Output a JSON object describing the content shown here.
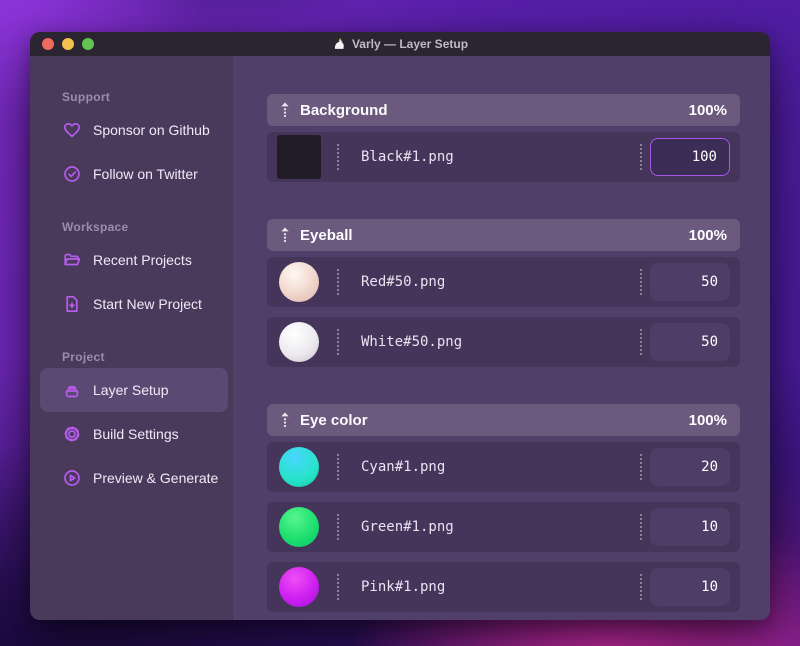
{
  "window": {
    "title": "Varly — Layer Setup",
    "app_icon": "unicorn-icon"
  },
  "sidebar": {
    "sections": [
      {
        "label": "Support",
        "items": [
          {
            "icon": "heart-icon",
            "label": "Sponsor on Github"
          },
          {
            "icon": "badge-check-icon",
            "label": "Follow on Twitter"
          }
        ]
      },
      {
        "label": "Workspace",
        "items": [
          {
            "icon": "folder-open-icon",
            "label": "Recent Projects"
          },
          {
            "icon": "file-plus-icon",
            "label": "Start New Project"
          }
        ]
      },
      {
        "label": "Project",
        "items": [
          {
            "icon": "layers-stack-icon",
            "label": "Layer Setup",
            "active": true
          },
          {
            "icon": "gear-icon",
            "label": "Build Settings"
          },
          {
            "icon": "play-circle-icon",
            "label": "Preview & Generate"
          }
        ]
      }
    ]
  },
  "main": {
    "groups": [
      {
        "name": "Background",
        "opacity": "100%",
        "layers": [
          {
            "thumb": "black-square",
            "file": "Black#1.png",
            "value": "100",
            "focused": true
          }
        ]
      },
      {
        "name": "Eyeball",
        "opacity": "100%",
        "layers": [
          {
            "thumb": "red-sphere",
            "file": "Red#50.png",
            "value": "50"
          },
          {
            "thumb": "white-sphere",
            "file": "White#50.png",
            "value": "50"
          }
        ]
      },
      {
        "name": "Eye color",
        "opacity": "100%",
        "layers": [
          {
            "thumb": "cyan-sphere",
            "file": "Cyan#1.png",
            "value": "20"
          },
          {
            "thumb": "green-sphere",
            "file": "Green#1.png",
            "value": "10"
          },
          {
            "thumb": "pink-sphere",
            "file": "Pink#1.png",
            "value": "10"
          }
        ]
      }
    ]
  },
  "colors": {
    "accent_purple": "#b75cec",
    "focus_border": "#a958e8",
    "sidebar_bg": "#493a5c",
    "main_bg": "#503f68",
    "header_bg": "#6b5a7e",
    "row_bg": "#45355a",
    "titlebar_bg": "#2b2532",
    "traffic_red": "#ed6a5e",
    "traffic_yellow": "#f4bf4f",
    "traffic_green": "#61c354"
  }
}
